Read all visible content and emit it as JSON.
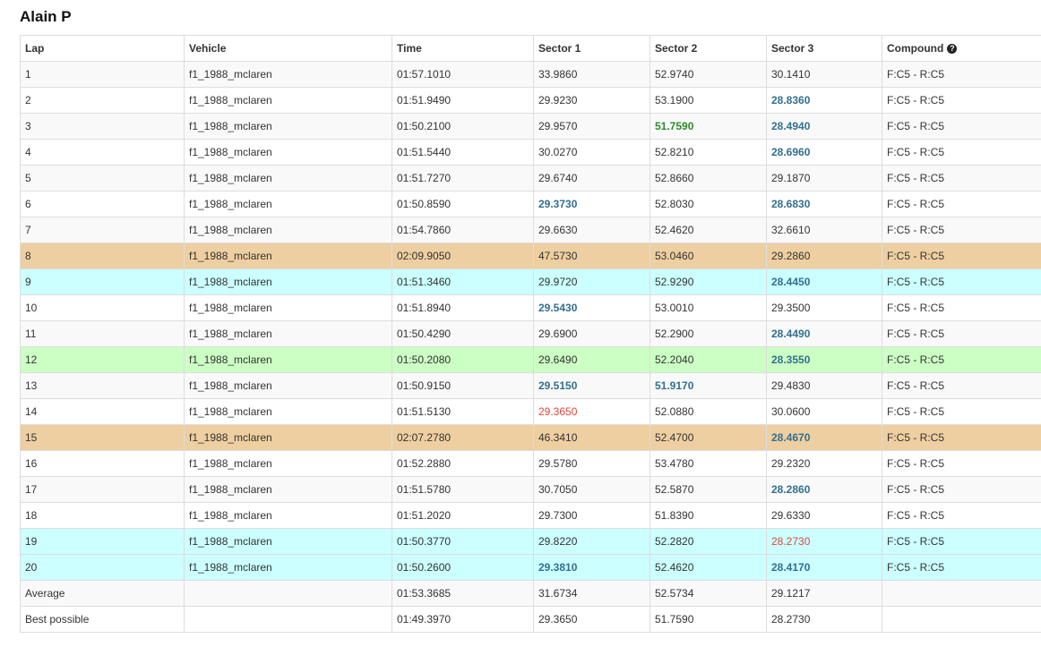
{
  "page": {
    "title": "Alain P"
  },
  "table": {
    "headers": {
      "lap": "Lap",
      "vehicle": "Vehicle",
      "time": "Time",
      "sector1": "Sector 1",
      "sector2": "Sector 2",
      "sector3": "Sector 3",
      "compound": "Compound",
      "compound_help_icon": "?"
    },
    "colors": {
      "pit_row": "#eecfa1",
      "cyan_row": "#ccffff",
      "green_row": "#ccffc4",
      "personal_best": "#31708f",
      "best_sector": "#2e8b2e",
      "overall_best": "#e0473d"
    },
    "rows": [
      {
        "lap": "1",
        "vehicle": "f1_1988_mclaren",
        "time": "01:57.1010",
        "s1": "33.9860",
        "s2": "52.9740",
        "s3": "30.1410",
        "compound": "F:C5 - R:C5",
        "row": "",
        "s1c": "",
        "s2c": "",
        "s3c": ""
      },
      {
        "lap": "2",
        "vehicle": "f1_1988_mclaren",
        "time": "01:51.9490",
        "s1": "29.9230",
        "s2": "53.1900",
        "s3": "28.8360",
        "compound": "F:C5 - R:C5",
        "row": "",
        "s1c": "",
        "s2c": "",
        "s3c": "pb"
      },
      {
        "lap": "3",
        "vehicle": "f1_1988_mclaren",
        "time": "01:50.2100",
        "s1": "29.9570",
        "s2": "51.7590",
        "s3": "28.4940",
        "compound": "F:C5 - R:C5",
        "row": "",
        "s1c": "",
        "s2c": "best",
        "s3c": "pb"
      },
      {
        "lap": "4",
        "vehicle": "f1_1988_mclaren",
        "time": "01:51.5440",
        "s1": "30.0270",
        "s2": "52.8210",
        "s3": "28.6960",
        "compound": "F:C5 - R:C5",
        "row": "",
        "s1c": "",
        "s2c": "",
        "s3c": "pb"
      },
      {
        "lap": "5",
        "vehicle": "f1_1988_mclaren",
        "time": "01:51.7270",
        "s1": "29.6740",
        "s2": "52.8660",
        "s3": "29.1870",
        "compound": "F:C5 - R:C5",
        "row": "",
        "s1c": "",
        "s2c": "",
        "s3c": ""
      },
      {
        "lap": "6",
        "vehicle": "f1_1988_mclaren",
        "time": "01:50.8590",
        "s1": "29.3730",
        "s2": "52.8030",
        "s3": "28.6830",
        "compound": "F:C5 - R:C5",
        "row": "",
        "s1c": "pb",
        "s2c": "",
        "s3c": "pb"
      },
      {
        "lap": "7",
        "vehicle": "f1_1988_mclaren",
        "time": "01:54.7860",
        "s1": "29.6630",
        "s2": "52.4620",
        "s3": "32.6610",
        "compound": "F:C5 - R:C5",
        "row": "",
        "s1c": "",
        "s2c": "",
        "s3c": ""
      },
      {
        "lap": "8",
        "vehicle": "f1_1988_mclaren",
        "time": "02:09.9050",
        "s1": "47.5730",
        "s2": "53.0460",
        "s3": "29.2860",
        "compound": "F:C5 - R:C5",
        "row": "pit",
        "s1c": "",
        "s2c": "",
        "s3c": ""
      },
      {
        "lap": "9",
        "vehicle": "f1_1988_mclaren",
        "time": "01:51.3460",
        "s1": "29.9720",
        "s2": "52.9290",
        "s3": "28.4450",
        "compound": "F:C5 - R:C5",
        "row": "cyan",
        "s1c": "",
        "s2c": "",
        "s3c": "pb"
      },
      {
        "lap": "10",
        "vehicle": "f1_1988_mclaren",
        "time": "01:51.8940",
        "s1": "29.5430",
        "s2": "53.0010",
        "s3": "29.3500",
        "compound": "F:C5 - R:C5",
        "row": "",
        "s1c": "pb",
        "s2c": "",
        "s3c": ""
      },
      {
        "lap": "11",
        "vehicle": "f1_1988_mclaren",
        "time": "01:50.4290",
        "s1": "29.6900",
        "s2": "52.2900",
        "s3": "28.4490",
        "compound": "F:C5 - R:C5",
        "row": "",
        "s1c": "",
        "s2c": "",
        "s3c": "pb"
      },
      {
        "lap": "12",
        "vehicle": "f1_1988_mclaren",
        "time": "01:50.2080",
        "s1": "29.6490",
        "s2": "52.2040",
        "s3": "28.3550",
        "compound": "F:C5 - R:C5",
        "row": "green",
        "s1c": "",
        "s2c": "",
        "s3c": "pb"
      },
      {
        "lap": "13",
        "vehicle": "f1_1988_mclaren",
        "time": "01:50.9150",
        "s1": "29.5150",
        "s2": "51.9170",
        "s3": "29.4830",
        "compound": "F:C5 - R:C5",
        "row": "",
        "s1c": "pb",
        "s2c": "pb",
        "s3c": ""
      },
      {
        "lap": "14",
        "vehicle": "f1_1988_mclaren",
        "time": "01:51.5130",
        "s1": "29.3650",
        "s2": "52.0880",
        "s3": "30.0600",
        "compound": "F:C5 - R:C5",
        "row": "",
        "s1c": "overall",
        "s2c": "",
        "s3c": ""
      },
      {
        "lap": "15",
        "vehicle": "f1_1988_mclaren",
        "time": "02:07.2780",
        "s1": "46.3410",
        "s2": "52.4700",
        "s3": "28.4670",
        "compound": "F:C5 - R:C5",
        "row": "pit",
        "s1c": "",
        "s2c": "",
        "s3c": "pb"
      },
      {
        "lap": "16",
        "vehicle": "f1_1988_mclaren",
        "time": "01:52.2880",
        "s1": "29.5780",
        "s2": "53.4780",
        "s3": "29.2320",
        "compound": "F:C5 - R:C5",
        "row": "",
        "s1c": "",
        "s2c": "",
        "s3c": ""
      },
      {
        "lap": "17",
        "vehicle": "f1_1988_mclaren",
        "time": "01:51.5780",
        "s1": "30.7050",
        "s2": "52.5870",
        "s3": "28.2860",
        "compound": "F:C5 - R:C5",
        "row": "",
        "s1c": "",
        "s2c": "",
        "s3c": "pb"
      },
      {
        "lap": "18",
        "vehicle": "f1_1988_mclaren",
        "time": "01:51.2020",
        "s1": "29.7300",
        "s2": "51.8390",
        "s3": "29.6330",
        "compound": "F:C5 - R:C5",
        "row": "",
        "s1c": "",
        "s2c": "",
        "s3c": ""
      },
      {
        "lap": "19",
        "vehicle": "f1_1988_mclaren",
        "time": "01:50.3770",
        "s1": "29.8220",
        "s2": "52.2820",
        "s3": "28.2730",
        "compound": "F:C5 - R:C5",
        "row": "cyan",
        "s1c": "",
        "s2c": "",
        "s3c": "overall"
      },
      {
        "lap": "20",
        "vehicle": "f1_1988_mclaren",
        "time": "01:50.2600",
        "s1": "29.3810",
        "s2": "52.4620",
        "s3": "28.4170",
        "compound": "F:C5 - R:C5",
        "row": "cyan",
        "s1c": "pb",
        "s2c": "",
        "s3c": "pb"
      }
    ],
    "summary": [
      {
        "label": "Average",
        "time": "01:53.3685",
        "s1": "31.6734",
        "s2": "52.5734",
        "s3": "29.1217"
      },
      {
        "label": "Best possible",
        "time": "01:49.3970",
        "s1": "29.3650",
        "s2": "51.7590",
        "s3": "28.2730"
      }
    ]
  }
}
